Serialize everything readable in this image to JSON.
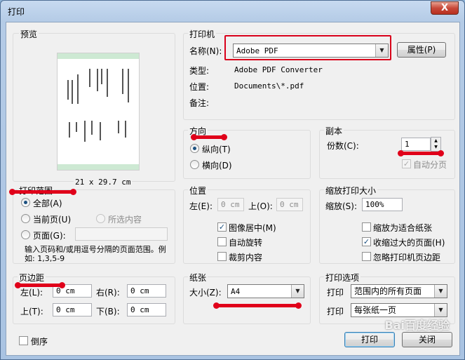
{
  "window": {
    "title": "打印",
    "close_label": "X"
  },
  "preview": {
    "label": "预览",
    "paper_size": "21 x 29.7 cm"
  },
  "printer": {
    "label": "打印机",
    "name_label": "名称(N):",
    "name_value": "Adobe PDF",
    "properties_label": "属性(P)",
    "type_label": "类型:",
    "type_value": "Adobe PDF Converter",
    "location_label": "位置:",
    "location_value": "Documents\\*.pdf",
    "comment_label": "备注:"
  },
  "orientation": {
    "label": "方向",
    "portrait": "纵向(T)",
    "landscape": "横向(D)"
  },
  "copies": {
    "label": "副本",
    "count_label": "份数(C):",
    "count_value": "1",
    "collate_label": "自动分页"
  },
  "print_range": {
    "label": "打印范围",
    "all": "全部(A)",
    "current_page": "当前页(U)",
    "selection": "所选内容",
    "pages": "页面(G):",
    "hint": "输入页码和/或用逗号分隔的页面范围。例如: 1,3,5-9"
  },
  "position": {
    "label": "位置",
    "left_label": "左(E):",
    "left_value": "0 cm",
    "top_label": "上(O):",
    "top_value": "0 cm",
    "center_label": "图像居中(M)",
    "autorotate_label": "自动旋转",
    "crop_label": "裁剪内容"
  },
  "scaling": {
    "label": "缩放打印大小",
    "scale_label": "缩放(S):",
    "scale_value": "100%",
    "fit_paper_label": "缩放为适合纸张",
    "shrink_label": "收缩过大的页面(H)",
    "ignore_margins_label": "忽略打印机页边距"
  },
  "margins": {
    "label": "页边距",
    "left_label": "左(L):",
    "left_value": "0 cm",
    "right_label": "右(R):",
    "right_value": "0 cm",
    "top_label": "上(T):",
    "top_value": "0 cm",
    "bottom_label": "下(B):",
    "bottom_value": "0 cm"
  },
  "paper": {
    "label": "纸张",
    "size_label": "大小(Z):",
    "size_value": "A4"
  },
  "print_options": {
    "label": "打印选项",
    "print_label_1": "打印",
    "print_value_1": "范围内的所有页面",
    "print_label_2": "打印",
    "print_value_2": "每张纸一页"
  },
  "footer": {
    "reverse_label": "倒序",
    "print_button": "打印",
    "close_button": "关闭"
  },
  "watermark": "Bai百度经验",
  "colors": {
    "annotation": "#e0001a",
    "titlebar": "#b4cbe6"
  }
}
